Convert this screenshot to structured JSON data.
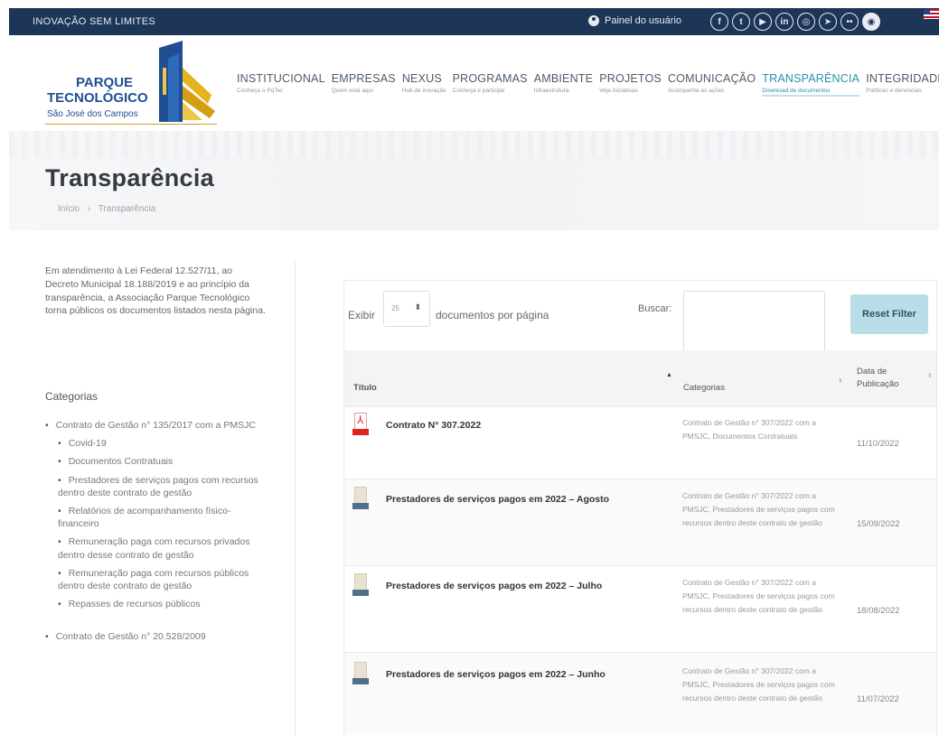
{
  "topbar": {
    "slogan": "INOVAÇÃO SEM LIMITES",
    "user_panel": "Painel do usuário",
    "social_icons": [
      "facebook-icon",
      "twitter-icon",
      "youtube-icon",
      "linkedin-icon",
      "instagram-icon",
      "telegram-icon",
      "flickr-icon",
      "spotify-icon"
    ],
    "social_glyphs": [
      "f",
      "t",
      "▶",
      "in",
      "◎",
      "➤",
      "••",
      "◉"
    ]
  },
  "logo": {
    "line1": "PARQUE",
    "line2": "TECNOLÓGICO",
    "line3": "São José dos Campos"
  },
  "nav": [
    {
      "label": "INSTITUCIONAL",
      "sub": "Conheça o PqTec"
    },
    {
      "label": "EMPRESAS",
      "sub": "Quem está aqui"
    },
    {
      "label": "NEXUS",
      "sub": "Hub de inovação"
    },
    {
      "label": "PROGRAMAS",
      "sub": "Conheça e participe"
    },
    {
      "label": "AMBIENTE",
      "sub": "Infraestrutura"
    },
    {
      "label": "PROJETOS",
      "sub": "Veja iniciativas"
    },
    {
      "label": "COMUNICAÇÃO",
      "sub": "Acompanhe as ações"
    },
    {
      "label": "TRANSPARÊNCIA",
      "sub": "Download de documentos",
      "active": true
    },
    {
      "label": "INTEGRIDADE",
      "sub": "Políticas e denúncias"
    }
  ],
  "page": {
    "title": "Transparência",
    "breadcrumb": [
      "Início",
      "›",
      "Transparência"
    ]
  },
  "sidebar": {
    "intro": "Em atendimento à Lei Federal 12.527/11, ao Decreto Municipal 18.188/2019 e ao princípio da transparência, a Associação Parque Tecnológico torna públicos os documentos listados nesta página.",
    "categories_title": "Categorias",
    "categories": [
      {
        "label": "Contrato de Gestão n° 135/2017 com a PMSJC",
        "level": 0
      },
      {
        "label": "Covid-19",
        "level": 1
      },
      {
        "label": "Documentos Contratuais",
        "level": 1
      },
      {
        "label": "Prestadores de serviços pagos com recursos dentro deste contrato de gestão",
        "level": 1
      },
      {
        "label": "Relatórios de acompanhamento físico-financeiro",
        "level": 1
      },
      {
        "label": "Remuneração paga com recursos privados dentro desse contrato de gestão",
        "level": 1
      },
      {
        "label": "Remuneração paga com recursos públicos dentro deste contrato de gestão",
        "level": 1
      },
      {
        "label": "Repasses de recursos públicos",
        "level": 1
      },
      {
        "label": "Contrato de Gestão n° 20.528/2009",
        "level": 0,
        "gap": true
      }
    ]
  },
  "table_controls": {
    "show_label": "Exibir",
    "page_size": "25",
    "per_page_label": "documentos por página",
    "search_label": "Buscar:",
    "search_value": "",
    "reset_label": "Reset Filter"
  },
  "table": {
    "columns": [
      "Título",
      "Categorias",
      "Data de Publicação"
    ],
    "rows": [
      {
        "icon": "pdf",
        "title": "Contrato N° 307.2022",
        "categories": "Contrato de Gestão n° 307/2022 com a PMSJC, Documentos Contratuais",
        "date": "11/10/2022"
      },
      {
        "icon": "doc",
        "title": "Prestadores de serviços pagos em 2022 – Agosto",
        "categories": "Contrato de Gestão n° 307/2022 com a PMSJC, Prestadores de serviços pagos com recursos dentro deste contrato de gestão",
        "date": "15/09/2022"
      },
      {
        "icon": "doc",
        "title": "Prestadores de serviços pagos em 2022 – Julho",
        "categories": "Contrato de Gestão n° 307/2022 com a PMSJC, Prestadores de serviços pagos com recursos dentro deste contrato de gestão",
        "date": "18/08/2022"
      },
      {
        "icon": "doc",
        "title": "Prestadores de serviços pagos em 2022 – Junho",
        "categories": "Contrato de Gestão n° 307/2022 com a PMSJC, Prestadores de serviços pagos com recursos dentro deste contrato de gestão",
        "date": "11/07/2022"
      }
    ]
  }
}
